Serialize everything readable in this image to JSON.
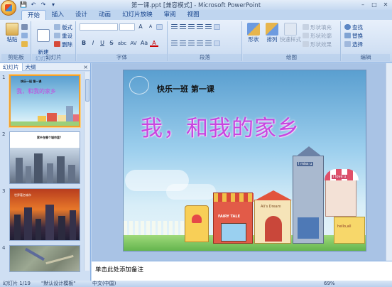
{
  "window": {
    "title": "第一课.ppt [兼容模式] - Microsoft PowerPoint",
    "controls": [
      "–",
      "□",
      "✕"
    ]
  },
  "quick_access": [
    "💾",
    "↶",
    "↷",
    "▾"
  ],
  "tabs": [
    "开始",
    "插入",
    "设计",
    "动画",
    "幻灯片放映",
    "审阅",
    "视图"
  ],
  "ribbon": {
    "clipboard": {
      "label": "剪贴板",
      "paste": "粘贴"
    },
    "slides": {
      "label": "幻灯片",
      "new_slide": "新建\n幻灯片",
      "layout": "版式",
      "reset": "重设",
      "delete": "删除"
    },
    "font": {
      "label": "字体",
      "grow": "A",
      "shrink": "A",
      "bold": "B",
      "italic": "I",
      "underline": "U",
      "strike": "S",
      "shadow": "abc",
      "spacing": "AV",
      "case": "Aa",
      "color": "A"
    },
    "paragraph": {
      "label": "段落"
    },
    "drawing": {
      "label": "绘图",
      "shapes": "形状",
      "arrange": "排列",
      "quick_styles": "快速样式",
      "fill": "形状填充",
      "outline": "形状轮廓",
      "effects": "形状效果"
    },
    "editing": {
      "label": "编辑",
      "find": "查找",
      "replace": "替换",
      "select": "选择"
    }
  },
  "pane": {
    "tabs": [
      "幻灯片",
      "大纲"
    ],
    "close": "×",
    "thumbs": [
      {
        "num": "1",
        "heading": "快乐一班 第一课",
        "title": "我，和我的家乡"
      },
      {
        "num": "2",
        "heading": "家乡在哪个城市里？",
        "title": ""
      },
      {
        "num": "3",
        "heading": "世界著名城市",
        "title": ""
      },
      {
        "num": "4",
        "heading": "",
        "title": ""
      }
    ]
  },
  "slide": {
    "heading": "快乐一班 第一课",
    "title": "我，和我的家乡",
    "signs": [
      "I miss u",
      "I love u",
      "FAIRY TALE",
      "Ali's Dream",
      "hello,all"
    ]
  },
  "notes": {
    "placeholder": "单击此处添加备注"
  },
  "status": {
    "slide_count": "幻灯片 1/19",
    "theme": "\"默认设计模板\"",
    "language": "中文(中国)",
    "zoom": "69%"
  }
}
